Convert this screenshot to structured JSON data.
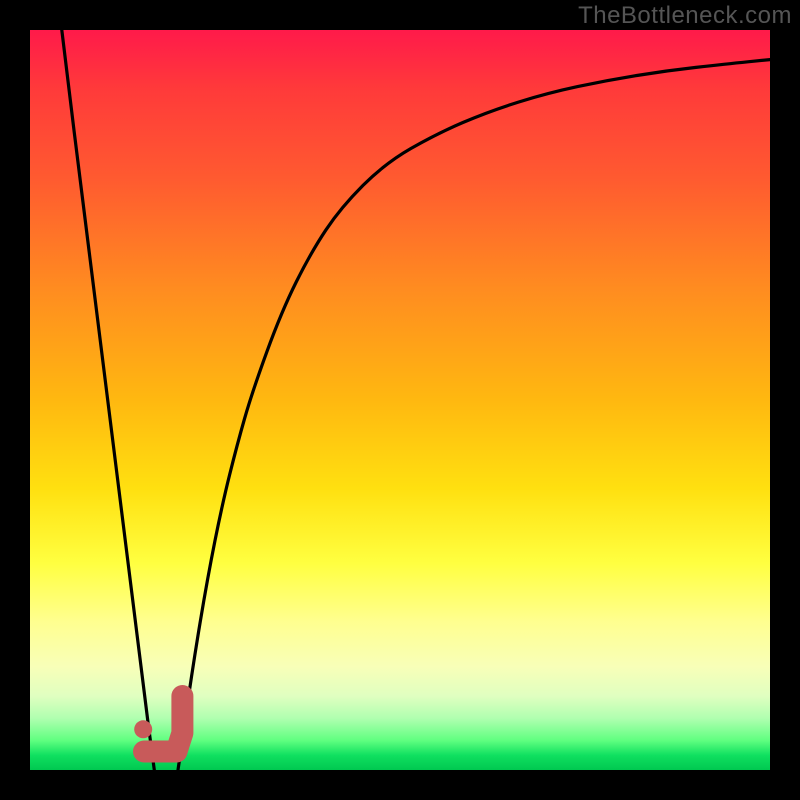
{
  "watermark": "TheBottleneck.com",
  "colors": {
    "frame": "#000000",
    "curve_stroke": "#000000",
    "marker_stroke": "#c85a5a",
    "marker_fill": "#c85a5a",
    "gradient_top": "#ff1a4a",
    "gradient_bottom": "#00c850"
  },
  "chart_data": {
    "type": "line",
    "title": "",
    "xlabel": "",
    "ylabel": "",
    "xlim": [
      0,
      100
    ],
    "ylim": [
      0,
      100
    ],
    "grid": false,
    "series": [
      {
        "name": "left-descent",
        "x": [
          4.3,
          6,
          8,
          10,
          12,
          14,
          16,
          16.8
        ],
        "values": [
          100,
          86,
          70,
          54,
          38,
          22,
          6,
          0
        ]
      },
      {
        "name": "right-curve",
        "x": [
          20,
          22,
          24,
          26,
          28,
          30,
          34,
          38,
          42,
          48,
          55,
          62,
          70,
          78,
          86,
          94,
          100
        ],
        "values": [
          0,
          14,
          26,
          36,
          44,
          51,
          62,
          70,
          76,
          82,
          86,
          89,
          91.5,
          93.2,
          94.5,
          95.4,
          96
        ]
      }
    ],
    "annotations": [
      {
        "name": "j-marker",
        "type": "path",
        "x": [
          15.4,
          19.8,
          20.6,
          20.6
        ],
        "y": [
          2.5,
          2.5,
          5,
          10
        ]
      },
      {
        "name": "j-dot",
        "type": "point",
        "x": 15.3,
        "y": 5.5
      }
    ]
  }
}
